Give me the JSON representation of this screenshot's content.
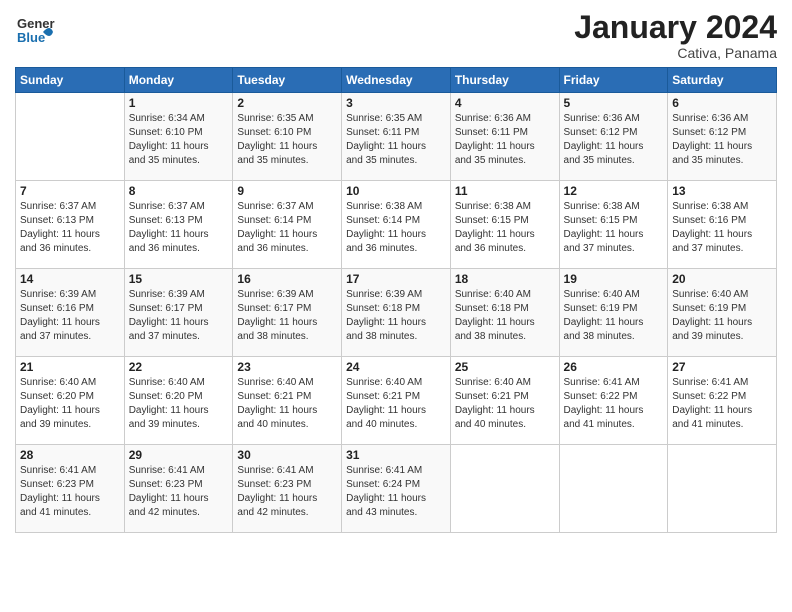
{
  "header": {
    "logo_general": "General",
    "logo_blue": "Blue",
    "month_title": "January 2024",
    "location": "Cativa, Panama"
  },
  "days_of_week": [
    "Sunday",
    "Monday",
    "Tuesday",
    "Wednesday",
    "Thursday",
    "Friday",
    "Saturday"
  ],
  "weeks": [
    [
      {
        "day": "",
        "info": ""
      },
      {
        "day": "1",
        "info": "Sunrise: 6:34 AM\nSunset: 6:10 PM\nDaylight: 11 hours\nand 35 minutes."
      },
      {
        "day": "2",
        "info": "Sunrise: 6:35 AM\nSunset: 6:10 PM\nDaylight: 11 hours\nand 35 minutes."
      },
      {
        "day": "3",
        "info": "Sunrise: 6:35 AM\nSunset: 6:11 PM\nDaylight: 11 hours\nand 35 minutes."
      },
      {
        "day": "4",
        "info": "Sunrise: 6:36 AM\nSunset: 6:11 PM\nDaylight: 11 hours\nand 35 minutes."
      },
      {
        "day": "5",
        "info": "Sunrise: 6:36 AM\nSunset: 6:12 PM\nDaylight: 11 hours\nand 35 minutes."
      },
      {
        "day": "6",
        "info": "Sunrise: 6:36 AM\nSunset: 6:12 PM\nDaylight: 11 hours\nand 35 minutes."
      }
    ],
    [
      {
        "day": "7",
        "info": "Sunrise: 6:37 AM\nSunset: 6:13 PM\nDaylight: 11 hours\nand 36 minutes."
      },
      {
        "day": "8",
        "info": "Sunrise: 6:37 AM\nSunset: 6:13 PM\nDaylight: 11 hours\nand 36 minutes."
      },
      {
        "day": "9",
        "info": "Sunrise: 6:37 AM\nSunset: 6:14 PM\nDaylight: 11 hours\nand 36 minutes."
      },
      {
        "day": "10",
        "info": "Sunrise: 6:38 AM\nSunset: 6:14 PM\nDaylight: 11 hours\nand 36 minutes."
      },
      {
        "day": "11",
        "info": "Sunrise: 6:38 AM\nSunset: 6:15 PM\nDaylight: 11 hours\nand 36 minutes."
      },
      {
        "day": "12",
        "info": "Sunrise: 6:38 AM\nSunset: 6:15 PM\nDaylight: 11 hours\nand 37 minutes."
      },
      {
        "day": "13",
        "info": "Sunrise: 6:38 AM\nSunset: 6:16 PM\nDaylight: 11 hours\nand 37 minutes."
      }
    ],
    [
      {
        "day": "14",
        "info": "Sunrise: 6:39 AM\nSunset: 6:16 PM\nDaylight: 11 hours\nand 37 minutes."
      },
      {
        "day": "15",
        "info": "Sunrise: 6:39 AM\nSunset: 6:17 PM\nDaylight: 11 hours\nand 37 minutes."
      },
      {
        "day": "16",
        "info": "Sunrise: 6:39 AM\nSunset: 6:17 PM\nDaylight: 11 hours\nand 38 minutes."
      },
      {
        "day": "17",
        "info": "Sunrise: 6:39 AM\nSunset: 6:18 PM\nDaylight: 11 hours\nand 38 minutes."
      },
      {
        "day": "18",
        "info": "Sunrise: 6:40 AM\nSunset: 6:18 PM\nDaylight: 11 hours\nand 38 minutes."
      },
      {
        "day": "19",
        "info": "Sunrise: 6:40 AM\nSunset: 6:19 PM\nDaylight: 11 hours\nand 38 minutes."
      },
      {
        "day": "20",
        "info": "Sunrise: 6:40 AM\nSunset: 6:19 PM\nDaylight: 11 hours\nand 39 minutes."
      }
    ],
    [
      {
        "day": "21",
        "info": "Sunrise: 6:40 AM\nSunset: 6:20 PM\nDaylight: 11 hours\nand 39 minutes."
      },
      {
        "day": "22",
        "info": "Sunrise: 6:40 AM\nSunset: 6:20 PM\nDaylight: 11 hours\nand 39 minutes."
      },
      {
        "day": "23",
        "info": "Sunrise: 6:40 AM\nSunset: 6:21 PM\nDaylight: 11 hours\nand 40 minutes."
      },
      {
        "day": "24",
        "info": "Sunrise: 6:40 AM\nSunset: 6:21 PM\nDaylight: 11 hours\nand 40 minutes."
      },
      {
        "day": "25",
        "info": "Sunrise: 6:40 AM\nSunset: 6:21 PM\nDaylight: 11 hours\nand 40 minutes."
      },
      {
        "day": "26",
        "info": "Sunrise: 6:41 AM\nSunset: 6:22 PM\nDaylight: 11 hours\nand 41 minutes."
      },
      {
        "day": "27",
        "info": "Sunrise: 6:41 AM\nSunset: 6:22 PM\nDaylight: 11 hours\nand 41 minutes."
      }
    ],
    [
      {
        "day": "28",
        "info": "Sunrise: 6:41 AM\nSunset: 6:23 PM\nDaylight: 11 hours\nand 41 minutes."
      },
      {
        "day": "29",
        "info": "Sunrise: 6:41 AM\nSunset: 6:23 PM\nDaylight: 11 hours\nand 42 minutes."
      },
      {
        "day": "30",
        "info": "Sunrise: 6:41 AM\nSunset: 6:23 PM\nDaylight: 11 hours\nand 42 minutes."
      },
      {
        "day": "31",
        "info": "Sunrise: 6:41 AM\nSunset: 6:24 PM\nDaylight: 11 hours\nand 43 minutes."
      },
      {
        "day": "",
        "info": ""
      },
      {
        "day": "",
        "info": ""
      },
      {
        "day": "",
        "info": ""
      }
    ]
  ]
}
